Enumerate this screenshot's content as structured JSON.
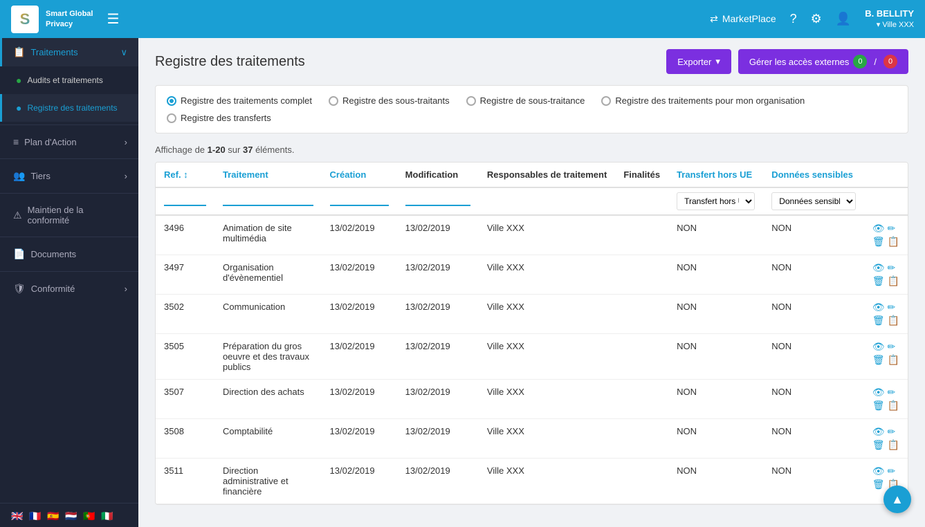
{
  "app": {
    "logo_letter": "S",
    "logo_name": "Smart Global\nPrivacy",
    "hamburger": "☰"
  },
  "topnav": {
    "marketplace_label": "MarketPlace",
    "marketplace_icon": "⇄",
    "help_icon": "?",
    "settings_icon": "⚙",
    "user_icon": "👤",
    "user_name": "B. BELLITY",
    "user_org": "▾ Ville XXX"
  },
  "sidebar": {
    "items": [
      {
        "id": "traitements",
        "label": "Traitements",
        "icon": "📋",
        "right": "↻",
        "active": true,
        "has_arrow": true
      },
      {
        "id": "audits",
        "label": "Audits et traitements",
        "icon": "⭕",
        "sub": true
      },
      {
        "id": "registre",
        "label": "Registre des traitements",
        "icon": "⭕",
        "sub": true,
        "active": true
      },
      {
        "id": "plan",
        "label": "Plan d'Action",
        "icon": "☰",
        "has_arrow": true
      },
      {
        "id": "tiers",
        "label": "Tiers",
        "icon": "👥",
        "has_arrow": true
      },
      {
        "id": "maintien",
        "label": "Maintien de la conformité",
        "icon": "⚠",
        "has_arrow": false
      },
      {
        "id": "documents",
        "label": "Documents",
        "icon": "📄"
      },
      {
        "id": "conformite",
        "label": "Conformité",
        "icon": "🛡",
        "has_arrow": true
      }
    ],
    "languages": [
      "🇬🇧",
      "🇫🇷",
      "🇪🇸",
      "🇳🇱",
      "🇵🇹",
      "🇮🇹"
    ]
  },
  "page": {
    "title": "Registre des traitements",
    "export_label": "Exporter",
    "manage_label": "Gérer les accès externes",
    "badge_green": "0",
    "badge_red": "0",
    "slash": "/",
    "count_text": "Affichage de ",
    "count_range": "1-20",
    "count_mid": " sur ",
    "count_total": "37",
    "count_end": " éléments."
  },
  "filters": [
    {
      "id": "complet",
      "label": "Registre des traitements complet",
      "checked": true
    },
    {
      "id": "sous-traitants",
      "label": "Registre des sous-traitants",
      "checked": false
    },
    {
      "id": "sous-traitance",
      "label": "Registre de sous-traitance",
      "checked": false
    },
    {
      "id": "organisation",
      "label": "Registre des traitements pour mon organisation",
      "checked": false
    },
    {
      "id": "transferts",
      "label": "Registre des transferts",
      "checked": false
    }
  ],
  "table": {
    "columns": [
      {
        "id": "ref",
        "label": "Ref. ↑↓",
        "blue": true
      },
      {
        "id": "traitement",
        "label": "Traitement",
        "blue": true
      },
      {
        "id": "creation",
        "label": "Création",
        "blue": true
      },
      {
        "id": "modification",
        "label": "Modification",
        "blue": false
      },
      {
        "id": "responsables",
        "label": "Responsables de traitement",
        "blue": false
      },
      {
        "id": "finalites",
        "label": "Finalités",
        "blue": false
      },
      {
        "id": "transfert",
        "label": "Transfert hors UE",
        "blue": true
      },
      {
        "id": "donnees",
        "label": "Données sensibles",
        "blue": true
      },
      {
        "id": "actions",
        "label": "",
        "blue": false
      }
    ],
    "filter_placeholders": {
      "transfert": "Transfert hors UE",
      "donnees": "Données sensibles"
    },
    "rows": [
      {
        "ref": "3496",
        "traitement": "Animation de site multimédia",
        "creation": "13/02/2019",
        "modification": "13/02/2019",
        "responsables": "Ville XXX",
        "finalites": "",
        "transfert": "NON",
        "donnees": "NON"
      },
      {
        "ref": "3497",
        "traitement": "Organisation d'évènementiel",
        "creation": "13/02/2019",
        "modification": "13/02/2019",
        "responsables": "Ville XXX",
        "finalites": "",
        "transfert": "NON",
        "donnees": "NON"
      },
      {
        "ref": "3502",
        "traitement": "Communication",
        "creation": "13/02/2019",
        "modification": "13/02/2019",
        "responsables": "Ville XXX",
        "finalites": "",
        "transfert": "NON",
        "donnees": "NON"
      },
      {
        "ref": "3505",
        "traitement": "Préparation du gros oeuvre et des travaux publics",
        "creation": "13/02/2019",
        "modification": "13/02/2019",
        "responsables": "Ville XXX",
        "finalites": "",
        "transfert": "NON",
        "donnees": "NON"
      },
      {
        "ref": "3507",
        "traitement": "Direction des achats",
        "creation": "13/02/2019",
        "modification": "13/02/2019",
        "responsables": "Ville XXX",
        "finalites": "",
        "transfert": "NON",
        "donnees": "NON"
      },
      {
        "ref": "3508",
        "traitement": "Comptabilité",
        "creation": "13/02/2019",
        "modification": "13/02/2019",
        "responsables": "Ville XXX",
        "finalites": "",
        "transfert": "NON",
        "donnees": "NON"
      },
      {
        "ref": "3511",
        "traitement": "Direction administrative et financière",
        "creation": "13/02/2019",
        "modification": "13/02/2019",
        "responsables": "Ville XXX",
        "finalites": "",
        "transfert": "NON",
        "donnees": "NON"
      }
    ]
  },
  "scroll_top_icon": "▲"
}
